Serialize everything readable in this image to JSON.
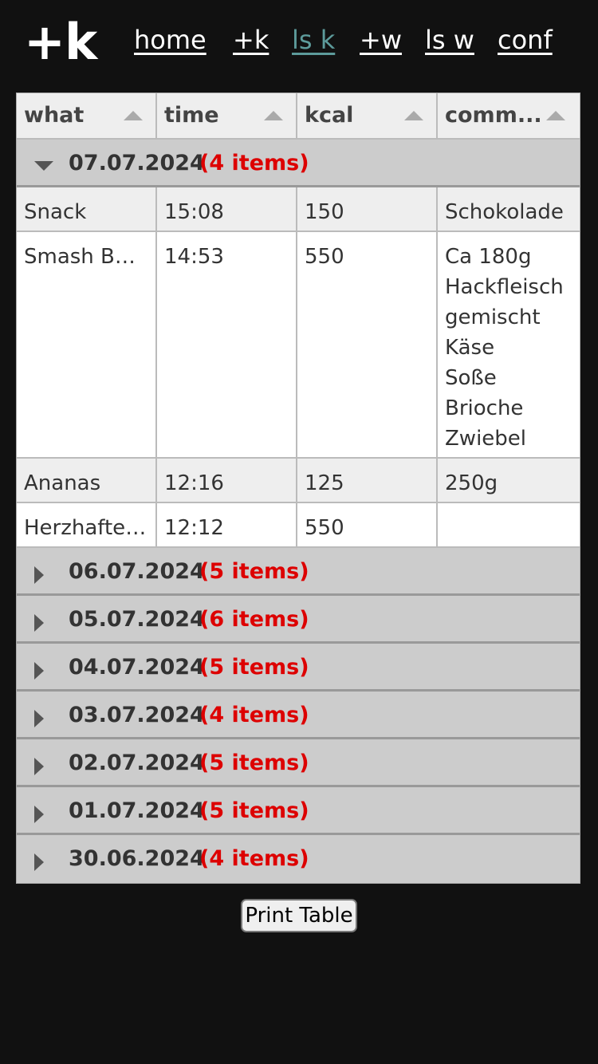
{
  "logo": "+k",
  "nav": [
    {
      "label": "home",
      "active": false
    },
    {
      "label": "+k",
      "active": false
    },
    {
      "label": "ls k",
      "active": true
    },
    {
      "label": "+w",
      "active": false
    },
    {
      "label": "ls w",
      "active": false
    },
    {
      "label": "conf",
      "active": false
    }
  ],
  "table": {
    "columns": [
      "what",
      "time",
      "kcal",
      "comm..."
    ],
    "expanded_group": {
      "date": "07.07.2024",
      "count": "(4 items)",
      "rows": [
        {
          "what": "Snack",
          "time": "15:08",
          "kcal": "150",
          "comment": "Schokolade"
        },
        {
          "what": "Smash Bur...",
          "time": "14:53",
          "kcal": "550",
          "comment": "Ca 180g\nHackfleisch\ngemischt\nKäse\nSoße\nBrioche\nZwiebel"
        },
        {
          "what": "Ananas",
          "time": "12:16",
          "kcal": "125",
          "comment": "250g"
        },
        {
          "what": "Herzhafte ...",
          "time": "12:12",
          "kcal": "550",
          "comment": ""
        }
      ]
    },
    "collapsed_groups": [
      {
        "date": "06.07.2024",
        "count": "(5 items)"
      },
      {
        "date": "05.07.2024",
        "count": "(6 items)"
      },
      {
        "date": "04.07.2024",
        "count": "(5 items)"
      },
      {
        "date": "03.07.2024",
        "count": "(4 items)"
      },
      {
        "date": "02.07.2024",
        "count": "(5 items)"
      },
      {
        "date": "01.07.2024",
        "count": "(5 items)"
      },
      {
        "date": "30.06.2024",
        "count": "(4 items)"
      }
    ]
  },
  "print_button": "Print Table",
  "colors": {
    "background": "#111111",
    "active_link": "#5d9b9b",
    "count": "#dd0000",
    "group_bg": "#cccccc"
  }
}
